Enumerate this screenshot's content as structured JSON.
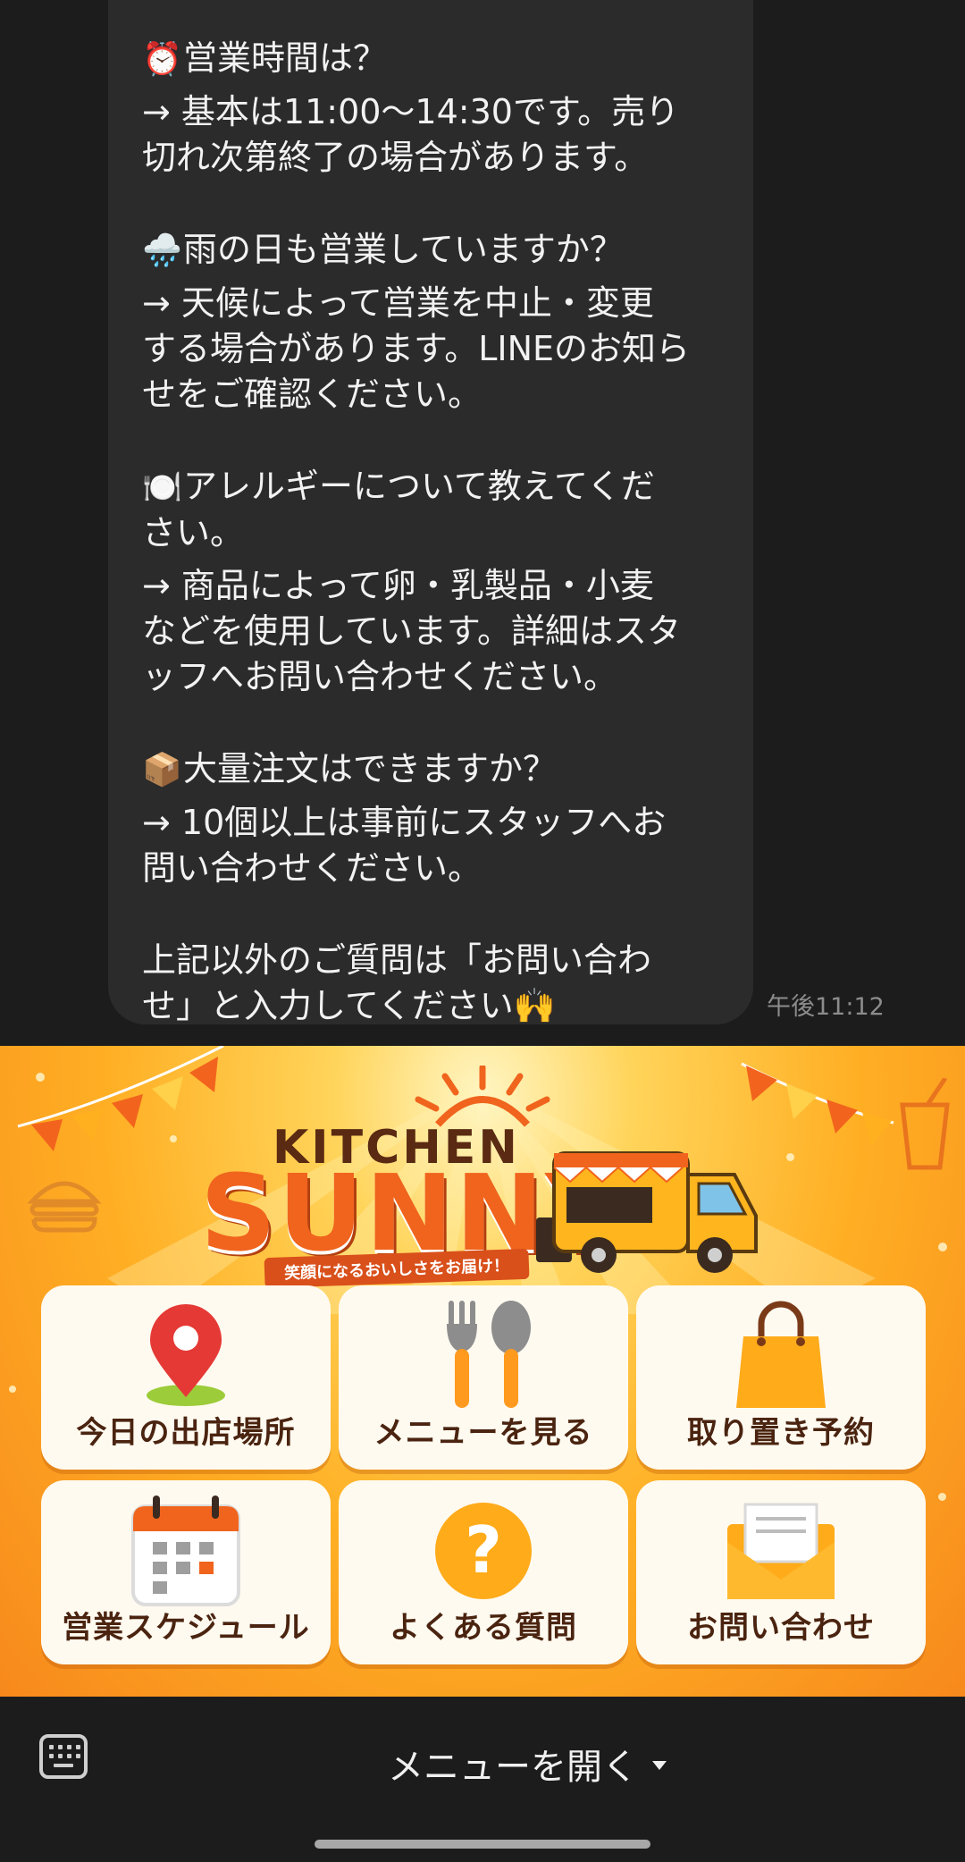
{
  "chat": {
    "faq": [
      {
        "emoji": "⏰",
        "question": "営業時間は？",
        "answer_lines": [
          "→ 基本は11:00〜14:30です。売り",
          "切れ次第終了の場合があります。"
        ]
      },
      {
        "emoji": "🌧️",
        "question": "雨の日も営業していますか？",
        "answer_lines": [
          "→ 天候によって営業を中止・変更",
          "する場合があります。LINEのお知ら",
          "せをご確認ください。"
        ]
      },
      {
        "emoji": "🍽️",
        "question": "アレルギーについて教えてくだ",
        "question_cont": "さい。",
        "answer_lines": [
          "→ 商品によって卵・乳製品・小麦",
          "などを使用しています。詳細はスタ",
          "ッフへお問い合わせください。"
        ]
      },
      {
        "emoji": "📦",
        "question": "大量注文はできますか？",
        "answer_lines": [
          "→ 10個以上は事前にスタッフへお",
          "問い合わせください。"
        ]
      }
    ],
    "closing_lines": [
      "上記以外のご質問は「お問い合わ",
      "せ」と入力してください🙌"
    ],
    "timestamp": "午後11:12"
  },
  "rich_menu": {
    "brand_top": "KITCHEN",
    "brand_main": "SUNNY",
    "tagline": "笑顔になるおいしさをお届け！",
    "buttons": [
      {
        "label": "今日の出店場所",
        "icon": "map-pin-icon"
      },
      {
        "label": "メニューを見る",
        "icon": "fork-spoon-icon"
      },
      {
        "label": "取り置き予約",
        "icon": "shopping-bag-icon"
      },
      {
        "label": "営業スケジュール",
        "icon": "calendar-icon"
      },
      {
        "label": "よくある質問",
        "icon": "question-icon"
      },
      {
        "label": "お問い合わせ",
        "icon": "envelope-icon"
      }
    ],
    "colors": {
      "primary": "#f0641d",
      "background": "#ffb020",
      "card": "#fffaf0",
      "text": "#4a2410"
    }
  },
  "bottom_bar": {
    "menu_toggle_label": "メニューを開く"
  }
}
